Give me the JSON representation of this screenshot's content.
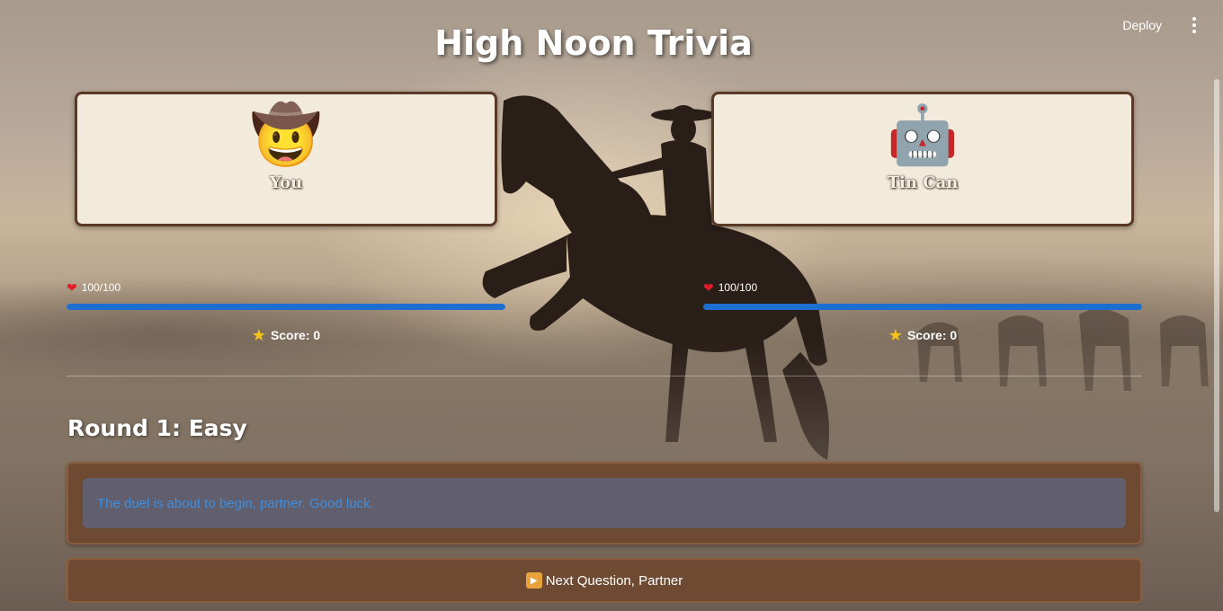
{
  "app": {
    "title": "High Noon Trivia",
    "deploy_label": "Deploy",
    "menu_icon": "more-vertical-icon"
  },
  "players": {
    "you": {
      "name": "You",
      "avatar": "🤠",
      "hp_text": "100/100",
      "hp_fraction": 1.0,
      "score_text": "Score: 0"
    },
    "cpu": {
      "name": "Tin Can",
      "avatar": "🤖",
      "hp_text": "100/100",
      "hp_fraction": 1.0,
      "score_text": "Score: 0"
    }
  },
  "round": {
    "heading": "Round 1: Easy"
  },
  "message": {
    "text": "The duel is about to begin, partner. Good luck."
  },
  "actions": {
    "next_label": "Next Question, Partner"
  },
  "colors": {
    "card_bg": "#f2eadb",
    "card_border": "#5a3a26",
    "hp_bar": "#1c6fd0",
    "panel_brown": "#6e4a33",
    "message_text": "#3d8fe0"
  }
}
